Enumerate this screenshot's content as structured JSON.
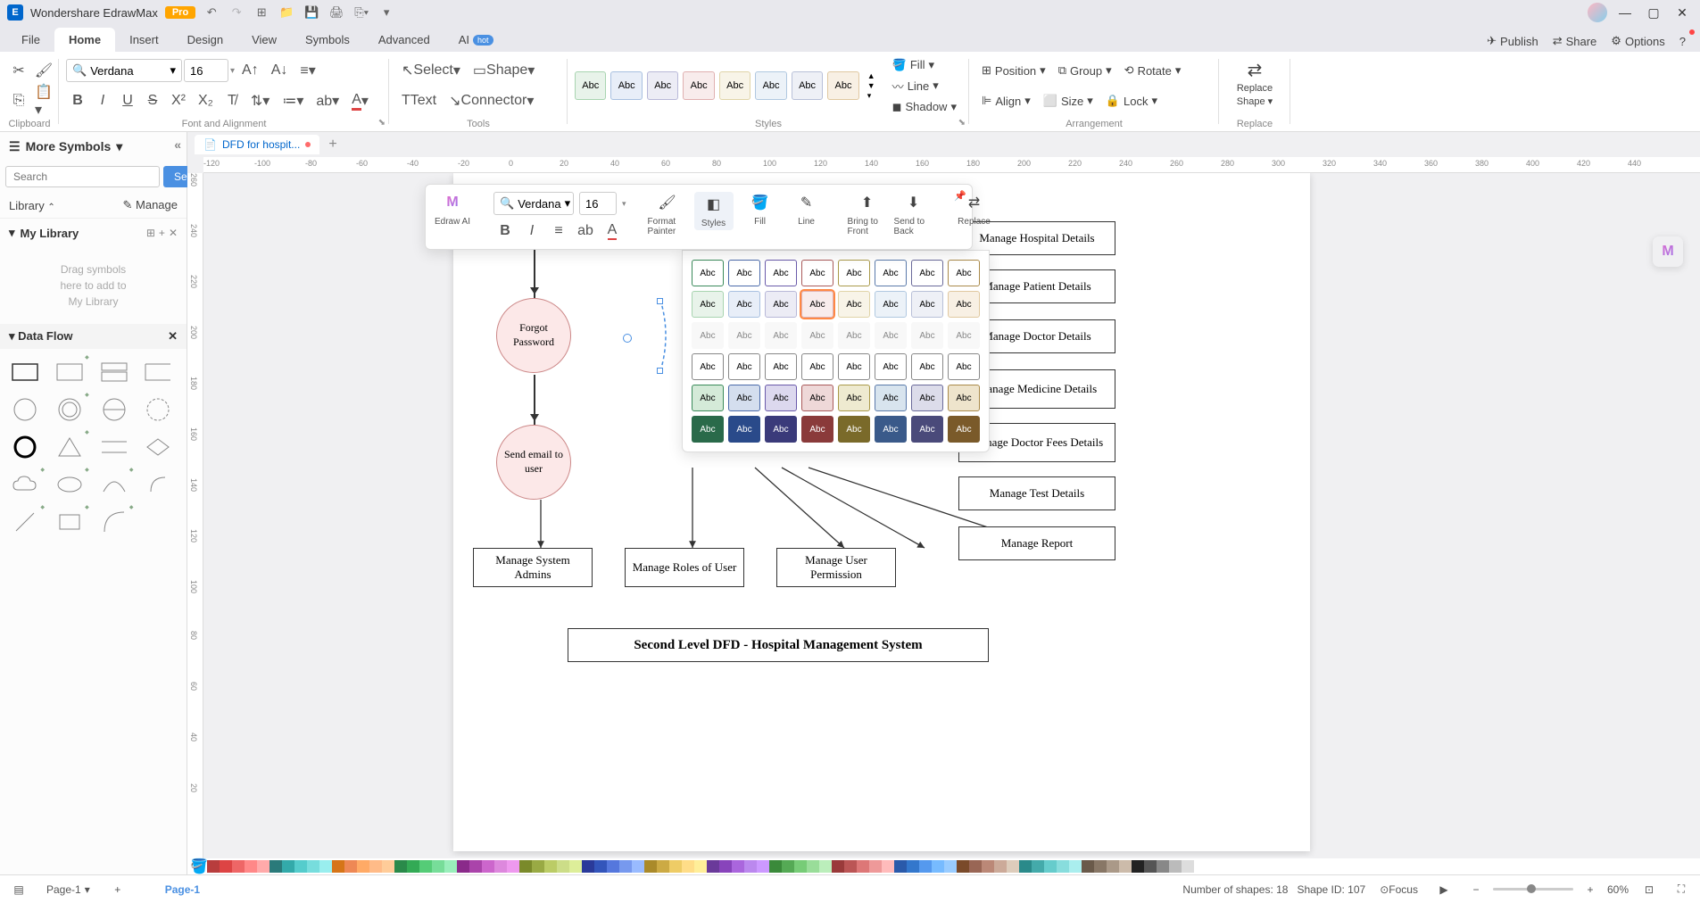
{
  "titlebar": {
    "app": "Wondershare EdrawMax",
    "badge": "Pro"
  },
  "menu": {
    "file": "File",
    "home": "Home",
    "insert": "Insert",
    "design": "Design",
    "view": "View",
    "symbols": "Symbols",
    "advanced": "Advanced",
    "ai": "AI",
    "hot": "hot",
    "publish": "Publish",
    "share": "Share",
    "options": "Options"
  },
  "ribbon": {
    "font": "Verdana",
    "size": "16",
    "select": "Select",
    "shape": "Shape",
    "text": "Text",
    "connector": "Connector",
    "fill": "Fill",
    "line": "Line",
    "shadow": "Shadow",
    "position": "Position",
    "align": "Align",
    "group": "Group",
    "size_label": "Size",
    "rotate": "Rotate",
    "lock": "Lock",
    "replace1": "Replace",
    "replace2": "Shape",
    "g_clipboard": "Clipboard",
    "g_font": "Font and Alignment",
    "g_tools": "Tools",
    "g_styles": "Styles",
    "g_arrangement": "Arrangement",
    "g_replace": "Replace",
    "abc": "Abc"
  },
  "left": {
    "more": "More Symbols",
    "search_ph": "Search",
    "search_btn": "Search",
    "library": "Library",
    "manage": "Manage",
    "mylib": "My Library",
    "hint1": "Drag symbols",
    "hint2": "here to add to",
    "hint3": "My Library",
    "dataflow": "Data Flow"
  },
  "doc_tab": "DFD for hospit...",
  "canvas": {
    "forgot": "Forgot Password",
    "send_email": "Send email to user",
    "sys_admins": "Manage System Admins",
    "roles": "Manage Roles of User",
    "user_perm": "Manage User Permission",
    "hosp_details": "Manage Hospital Details",
    "patient": "Manage Patient Details",
    "doctor": "Manage Doctor Details",
    "medicine": "Manage Medicine Details",
    "doctor_fees": "Manage Doctor Fees Details",
    "test": "Manage Test Details",
    "report": "Manage Report",
    "title_box": "Second Level DFD - Hospital Management System"
  },
  "float": {
    "font": "Verdana",
    "size": "16",
    "edraw_ai": "Edraw AI",
    "format_painter": "Format Painter",
    "styles": "Styles",
    "fill": "Fill",
    "line": "Line",
    "bring_front": "Bring to Front",
    "send_back": "Send to Back",
    "replace": "Replace",
    "abc": "Abc"
  },
  "ruler_h": [
    "-120",
    "-100",
    "-80",
    "-60",
    "-40",
    "-20",
    "0",
    "20",
    "40",
    "60",
    "80",
    "100",
    "120",
    "140",
    "160",
    "180",
    "200",
    "220",
    "240",
    "260",
    "280",
    "300",
    "320",
    "340",
    "360",
    "380",
    "400",
    "420",
    "440"
  ],
  "ruler_v": [
    "260",
    "240",
    "220",
    "200",
    "180",
    "160",
    "140",
    "120",
    "100",
    "80",
    "60",
    "40",
    "20"
  ],
  "status": {
    "page": "Page-1",
    "page_label": "Page-1",
    "shapes": "Number of shapes: 18",
    "shape_id": "Shape ID: 107",
    "focus": "Focus",
    "zoom": "60%"
  },
  "colors": [
    "#b83d3d",
    "#d44",
    "#e66",
    "#f88",
    "#faa",
    "#2a7a7a",
    "#3aa",
    "#5cc",
    "#7dd",
    "#9ee",
    "#d67518",
    "#e85",
    "#fa6",
    "#fb8",
    "#fc9",
    "#2a8a4a",
    "#3a5",
    "#5c7",
    "#7d9",
    "#9eb",
    "#8a2a8a",
    "#a4a",
    "#c6c",
    "#d8d",
    "#e9e",
    "#7a8a2a",
    "#9a4",
    "#bc6",
    "#cd8",
    "#de9",
    "#2a3a9a",
    "#35b",
    "#57d",
    "#79e",
    "#9bf",
    "#aa8a2a",
    "#ca4",
    "#ec6",
    "#fd8",
    "#fe9",
    "#6a3a9a",
    "#84b",
    "#a6d",
    "#b8e",
    "#c9f",
    "#3a8a3a",
    "#5a5",
    "#7c7",
    "#9d9",
    "#beb",
    "#9a3a3a",
    "#b55",
    "#d77",
    "#e99",
    "#fbb",
    "#2a5aaa",
    "#37c",
    "#59e",
    "#7bf",
    "#9cf",
    "#7a4a2a",
    "#965",
    "#b87",
    "#ca9",
    "#dcb",
    "#2a8a8a",
    "#4aa",
    "#6cc",
    "#8dd",
    "#aee",
    "#6a5a4a",
    "#876",
    "#a98",
    "#cba",
    "#222",
    "#555",
    "#888",
    "#bbb",
    "#ddd",
    "#fff"
  ]
}
